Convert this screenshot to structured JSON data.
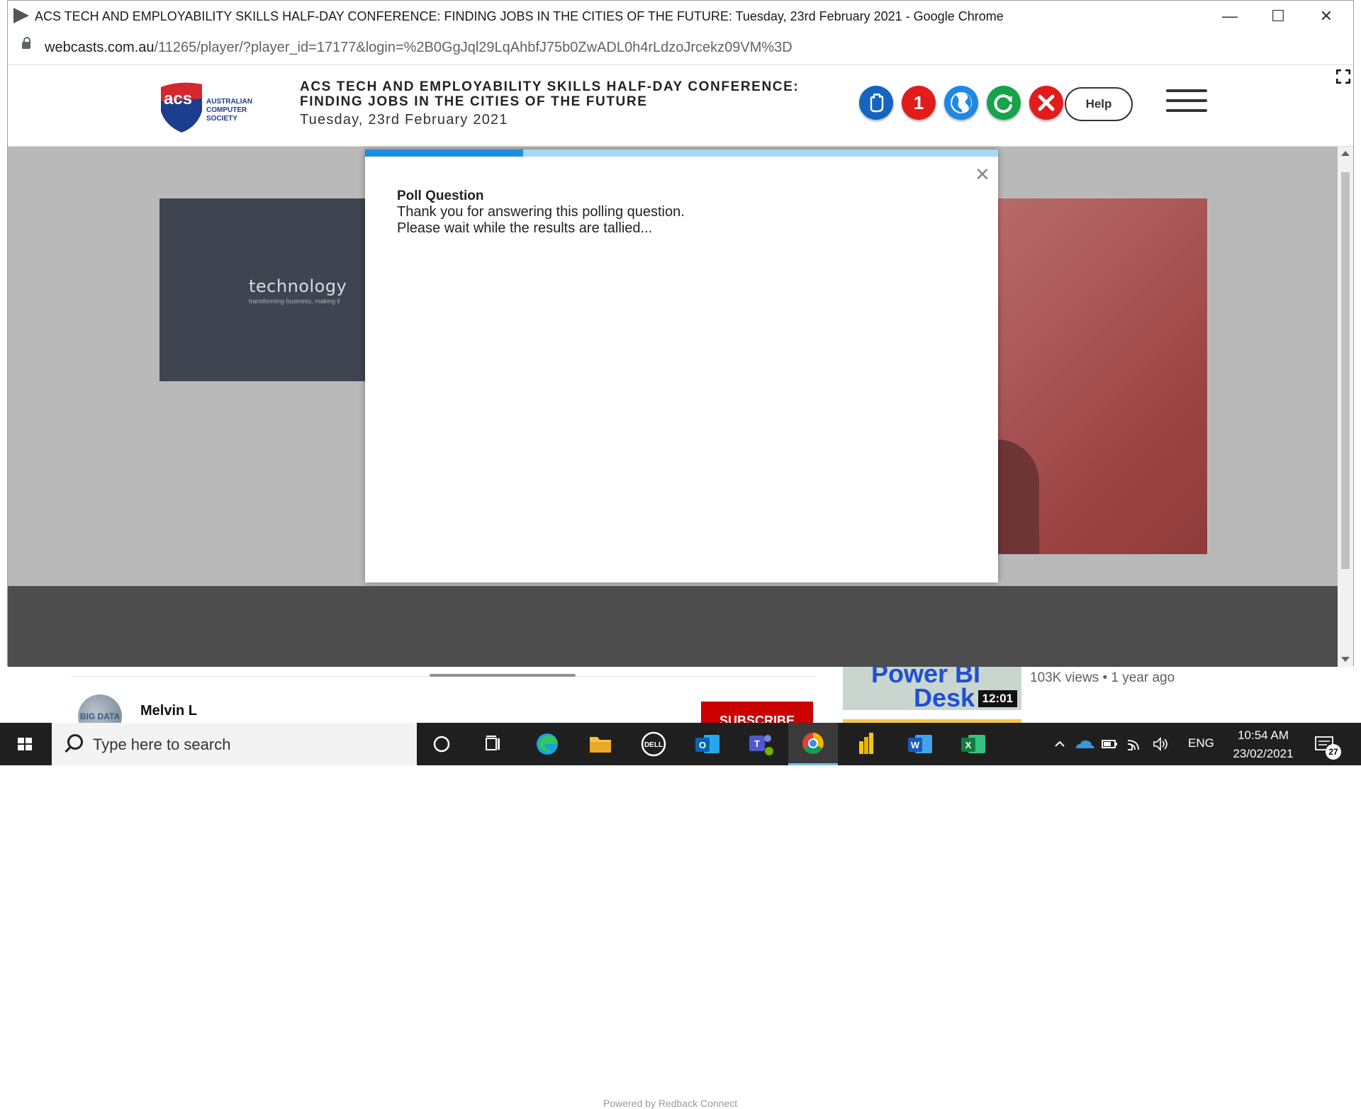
{
  "window": {
    "title": "ACS TECH AND EMPLOYABILITY SKILLS HALF-DAY CONFERENCE: FINDING JOBS IN THE CITIES OF THE FUTURE: Tuesday, 23rd February 2021 - Google Chrome",
    "minimize": "—",
    "maximize": "☐",
    "close": "✕"
  },
  "address_bar": {
    "host": "webcasts.com.au",
    "path": "/11265/player/?player_id=17177&login=%2B0GgJql29LqAhbfJ75b0ZwADL0h4rLdzoJrcekz09VM%3D"
  },
  "header": {
    "logo_text": "acs",
    "logo_org": [
      "AUSTRALIAN",
      "COMPUTER",
      "SOCIETY"
    ],
    "title_line1": "ACS TECH AND EMPLOYABILITY SKILLS HALF-DAY CONFERENCE:",
    "title_line2": "FINDING JOBS IN THE CITIES OF THE FUTURE",
    "date": "Tuesday, 23rd February 2021",
    "icons": [
      {
        "name": "raise-hand-icon",
        "color": "#1565c0"
      },
      {
        "name": "notification-count-icon",
        "color": "#e21b1b",
        "label": "1"
      },
      {
        "name": "globe-icon",
        "color": "#1e88e5"
      },
      {
        "name": "refresh-icon",
        "color": "#17a34a"
      },
      {
        "name": "exit-icon",
        "color": "#e21b1b"
      }
    ],
    "help_label": "Help"
  },
  "video": {
    "slide_brand": "technology",
    "slide_tagline": "transforming business, making li",
    "powered_by": "Powered by Redback Connect"
  },
  "poll": {
    "progress": 0.25,
    "heading": "Poll Question",
    "message_line1": "Thank you for answering this polling question.",
    "message_line2": "Please wait while the results are tallied..."
  },
  "background_page": {
    "channel": "Melvin L",
    "avatar_text": "BIG DATA",
    "subscribe": "SUBSCRIBE",
    "thumb_title_1": "Power BI",
    "thumb_title_2": "Desk",
    "thumb_duration": "12:01",
    "views": "103K views • 1 year ago"
  },
  "taskbar": {
    "search_placeholder": "Type here to search",
    "lang": "ENG",
    "time": "10:54 AM",
    "date": "23/02/2021",
    "notifications": "27",
    "apps": [
      "cortana",
      "task-view",
      "edge",
      "file-explorer",
      "dell",
      "outlook",
      "teams",
      "chrome",
      "power-bi",
      "word",
      "excel"
    ]
  },
  "colors": {
    "accent_blue": "#1a8fe0",
    "progress_track": "#a6d8f7",
    "acs_red": "#d7262e",
    "acs_navy": "#1c3c8c"
  }
}
